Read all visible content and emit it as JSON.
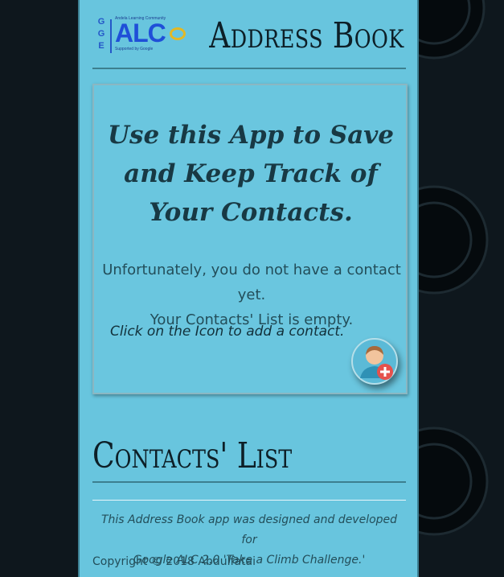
{
  "header": {
    "logo": {
      "community_text": "Andela Learning Community",
      "wordmark": "ALC",
      "supported_text": "Supported by Google",
      "side_letters": "G G E"
    },
    "title": "Address Book"
  },
  "intro_card": {
    "title": "Use this App to Save and Keep Track of Your Contacts.",
    "empty_line1": "Unfortunately, you do not have a contact yet.",
    "empty_line2": "Your Contacts' List is empty.",
    "hint": "Click on the Icon to add a contact.",
    "add_icon": "add-contact-icon"
  },
  "contacts_section": {
    "heading": "Contacts' List",
    "items": []
  },
  "footer": {
    "note_line1": "This Address Book app was designed and developed for",
    "note_line2": "Google ALC 2.0 'Take a Climb Challenge.'",
    "copyright": "Copyright © 2018 Abdulfatai"
  },
  "colors": {
    "page_background": "#0e171d",
    "app_background": "#68c5de",
    "heading_text": "#0d1f27",
    "body_text": "#234e5a"
  }
}
